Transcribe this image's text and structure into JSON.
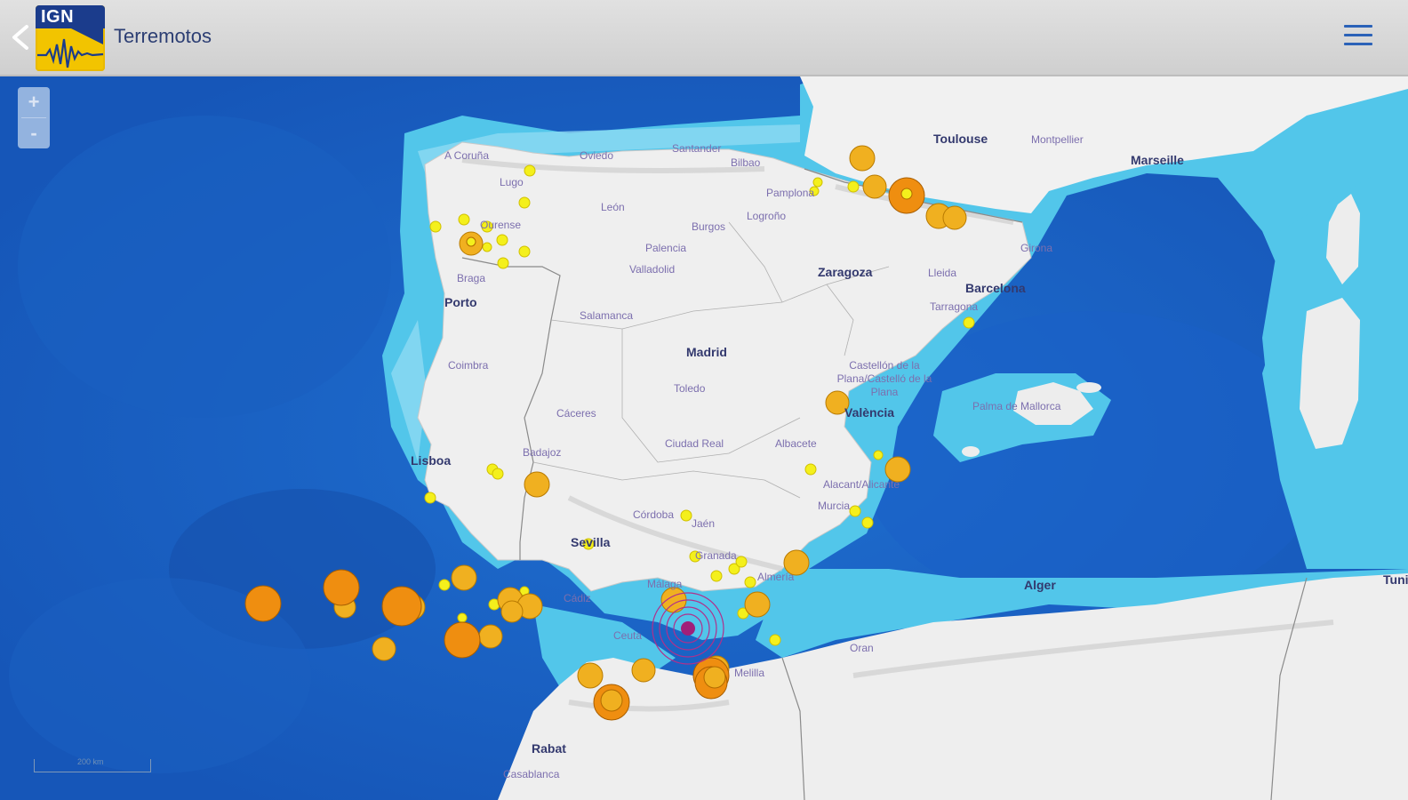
{
  "app": {
    "title": "Terremotos",
    "logo_text": "IGN",
    "brand_color": "#1b3c8c",
    "logo_color": "#f2c400"
  },
  "header": {
    "back_icon": "chevron-left-icon",
    "menu_icon": "hamburger-menu-icon"
  },
  "map_controls": {
    "zoom_in_label": "+",
    "zoom_out_label": "-",
    "scale_label": "200 km"
  },
  "cities": [
    {
      "name": "A Coruña",
      "class": "minor"
    },
    {
      "name": "Oviedo",
      "class": "minor"
    },
    {
      "name": "Santander",
      "class": "minor"
    },
    {
      "name": "Bilbao",
      "class": "minor"
    },
    {
      "name": "Lugo",
      "class": "minor"
    },
    {
      "name": "León",
      "class": "minor"
    },
    {
      "name": "Pamplona",
      "class": "minor"
    },
    {
      "name": "Logroño",
      "class": "minor"
    },
    {
      "name": "Burgos",
      "class": "minor"
    },
    {
      "name": "Ourense",
      "class": "minor"
    },
    {
      "name": "Palencia",
      "class": "minor"
    },
    {
      "name": "Valladolid",
      "class": "minor"
    },
    {
      "name": "Braga",
      "class": "minor"
    },
    {
      "name": "Porto",
      "class": "major"
    },
    {
      "name": "Salamanca",
      "class": "minor"
    },
    {
      "name": "Zaragoza",
      "class": "major"
    },
    {
      "name": "Lleida",
      "class": "minor"
    },
    {
      "name": "Girona",
      "class": "minor"
    },
    {
      "name": "Barcelona",
      "class": "major"
    },
    {
      "name": "Tarragona",
      "class": "minor"
    },
    {
      "name": "Madrid",
      "class": "major"
    },
    {
      "name": "Coimbra",
      "class": "minor"
    },
    {
      "name": "Toledo",
      "class": "minor"
    },
    {
      "name": "Castellón de la Plana/Castelló de la Plana",
      "class": "minor"
    },
    {
      "name": "València",
      "class": "major"
    },
    {
      "name": "Palma de Mallorca",
      "class": "minor"
    },
    {
      "name": "Cáceres",
      "class": "minor"
    },
    {
      "name": "Ciudad Real",
      "class": "minor"
    },
    {
      "name": "Albacete",
      "class": "minor"
    },
    {
      "name": "Lisboa",
      "class": "major"
    },
    {
      "name": "Badajoz",
      "class": "minor"
    },
    {
      "name": "Alacant/Alicante",
      "class": "minor"
    },
    {
      "name": "Murcia",
      "class": "minor"
    },
    {
      "name": "Córdoba",
      "class": "minor"
    },
    {
      "name": "Jaén",
      "class": "minor"
    },
    {
      "name": "Sevilla",
      "class": "major"
    },
    {
      "name": "Granada",
      "class": "minor"
    },
    {
      "name": "Málaga",
      "class": "minor"
    },
    {
      "name": "Almería",
      "class": "minor"
    },
    {
      "name": "Cádiz",
      "class": "minor"
    },
    {
      "name": "Ceuta",
      "class": "minor"
    },
    {
      "name": "Melilla",
      "class": "minor"
    },
    {
      "name": "Oran",
      "class": "minor"
    },
    {
      "name": "Rabat",
      "class": "major"
    },
    {
      "name": "Casablanca",
      "class": "minor"
    },
    {
      "name": "Alger",
      "class": "major"
    },
    {
      "name": "Toulouse",
      "class": "major"
    },
    {
      "name": "Montpellier",
      "class": "minor"
    },
    {
      "name": "Marseille",
      "class": "major"
    },
    {
      "name": "Tunis",
      "class": "major"
    }
  ],
  "earthquake_colors": {
    "small": "#f4f01c",
    "medium": "#f0b020",
    "large": "#ef8e10",
    "latest": "#a0207a"
  }
}
